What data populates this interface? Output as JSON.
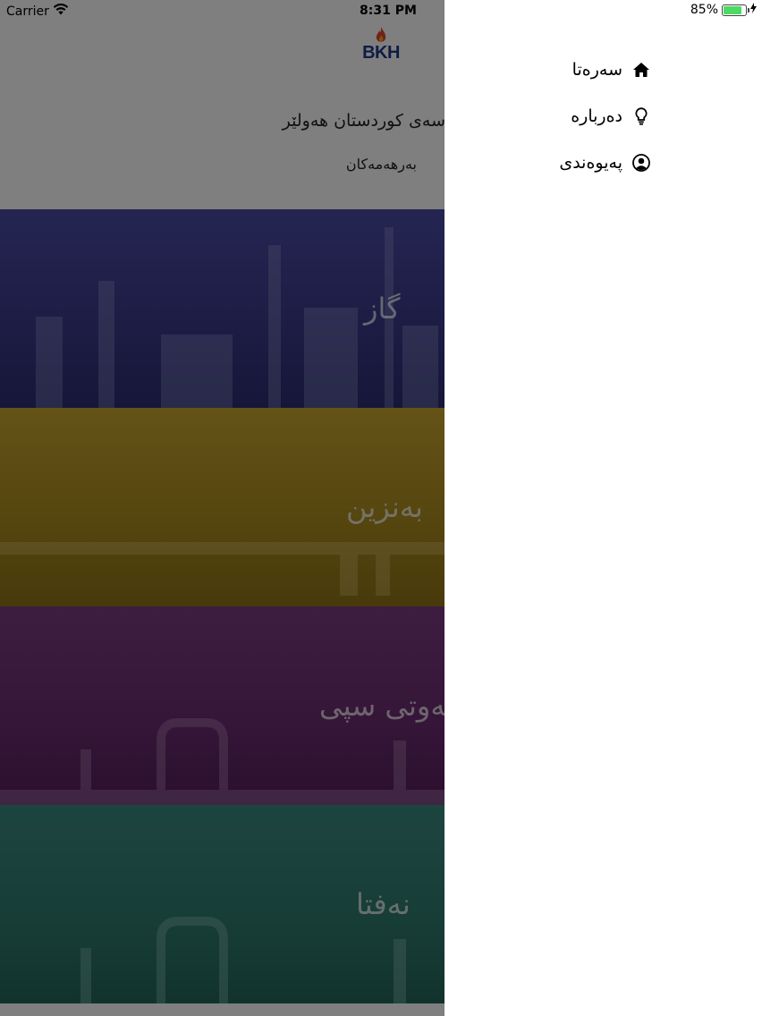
{
  "status_bar": {
    "carrier": "Carrier",
    "time": "8:31 PM",
    "battery_percent": "85%",
    "battery_level": 0.85,
    "icons": [
      "wifi-icon",
      "battery-icon",
      "charging-bolt-icon"
    ]
  },
  "navbar": {
    "logo_text": "BKH"
  },
  "header": {
    "company_name": "سەی کوردستان هەولێر",
    "products_label": "بەرهەمەکان"
  },
  "products": [
    {
      "label": "گاز",
      "color": "#3a3a8c"
    },
    {
      "label": "بەنزین",
      "color": "#a98a1e"
    },
    {
      "label": "نەوتی سپی",
      "color": "#6a2a70"
    },
    {
      "label": "نەفتا",
      "color": "#2f7a6e"
    }
  ],
  "drawer": {
    "menu": [
      {
        "label": "سەرەتا",
        "icon": "home-icon"
      },
      {
        "label": "دەربارە",
        "icon": "lightbulb-icon"
      },
      {
        "label": "پەیوەندی",
        "icon": "user-circle-icon"
      }
    ]
  },
  "colors": {
    "overlay": "rgba(0,0,0,0.5)",
    "battery_fill": "#4cd964",
    "logo_blue": "#1e3a8a",
    "logo_flame": "#e0452b"
  }
}
